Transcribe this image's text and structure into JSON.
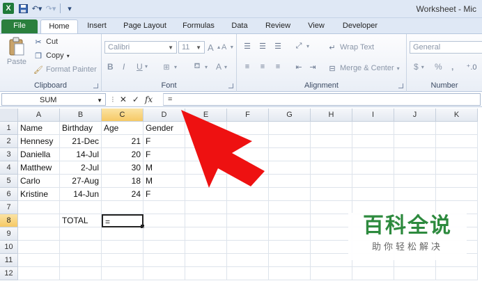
{
  "window": {
    "title": "Worksheet - Mic"
  },
  "tabs": [
    "File",
    "Home",
    "Insert",
    "Page Layout",
    "Formulas",
    "Data",
    "Review",
    "View",
    "Developer"
  ],
  "ribbon": {
    "clipboard": {
      "paste": "Paste",
      "cut": "Cut",
      "copy": "Copy",
      "format_painter": "Format Painter",
      "label": "Clipboard"
    },
    "font": {
      "name": "Calibri",
      "size": "11",
      "bold": "B",
      "italic": "I",
      "underline": "U",
      "grow": "A",
      "shrink": "A",
      "color": "A",
      "label": "Font"
    },
    "alignment": {
      "wrap_text": "Wrap Text",
      "merge_center": "Merge & Center",
      "label": "Alignment"
    },
    "number": {
      "format": "General",
      "currency": "$",
      "percent": "%",
      "comma": ",",
      "label": "Number"
    }
  },
  "formula_bar": {
    "name_box": "SUM",
    "cancel": "✕",
    "enter": "✓",
    "fx": "fx",
    "value": "="
  },
  "columns": [
    "A",
    "B",
    "C",
    "D",
    "E",
    "F",
    "G",
    "H",
    "I",
    "J",
    "K"
  ],
  "rows": [
    "1",
    "2",
    "3",
    "4",
    "5",
    "6",
    "7",
    "8",
    "9",
    "10",
    "11",
    "12"
  ],
  "cells": {
    "A1": "Name",
    "B1": "Birthday",
    "C1": "Age",
    "D1": "Gender",
    "A2": "Hennesy",
    "B2": "21-Dec",
    "C2": "21",
    "D2": "F",
    "A3": "Daniella",
    "B3": "14-Jul",
    "C3": "20",
    "D3": "F",
    "A4": "Matthew",
    "B4": "2-Jul",
    "C4": "30",
    "D4": "M",
    "A5": "Carlo",
    "B5": "27-Aug",
    "C5": "18",
    "D5": "M",
    "A6": "Kristine",
    "B6": "14-Jun",
    "C6": "24",
    "D6": "F",
    "B8": "TOTAL",
    "C8": "="
  },
  "watermark": {
    "main": "百科全说",
    "sub": "助你轻松解决"
  },
  "colors": {
    "file_tab": "#2a7f3d",
    "selection_header": "#f6c965",
    "arrow": "#ee1111"
  }
}
